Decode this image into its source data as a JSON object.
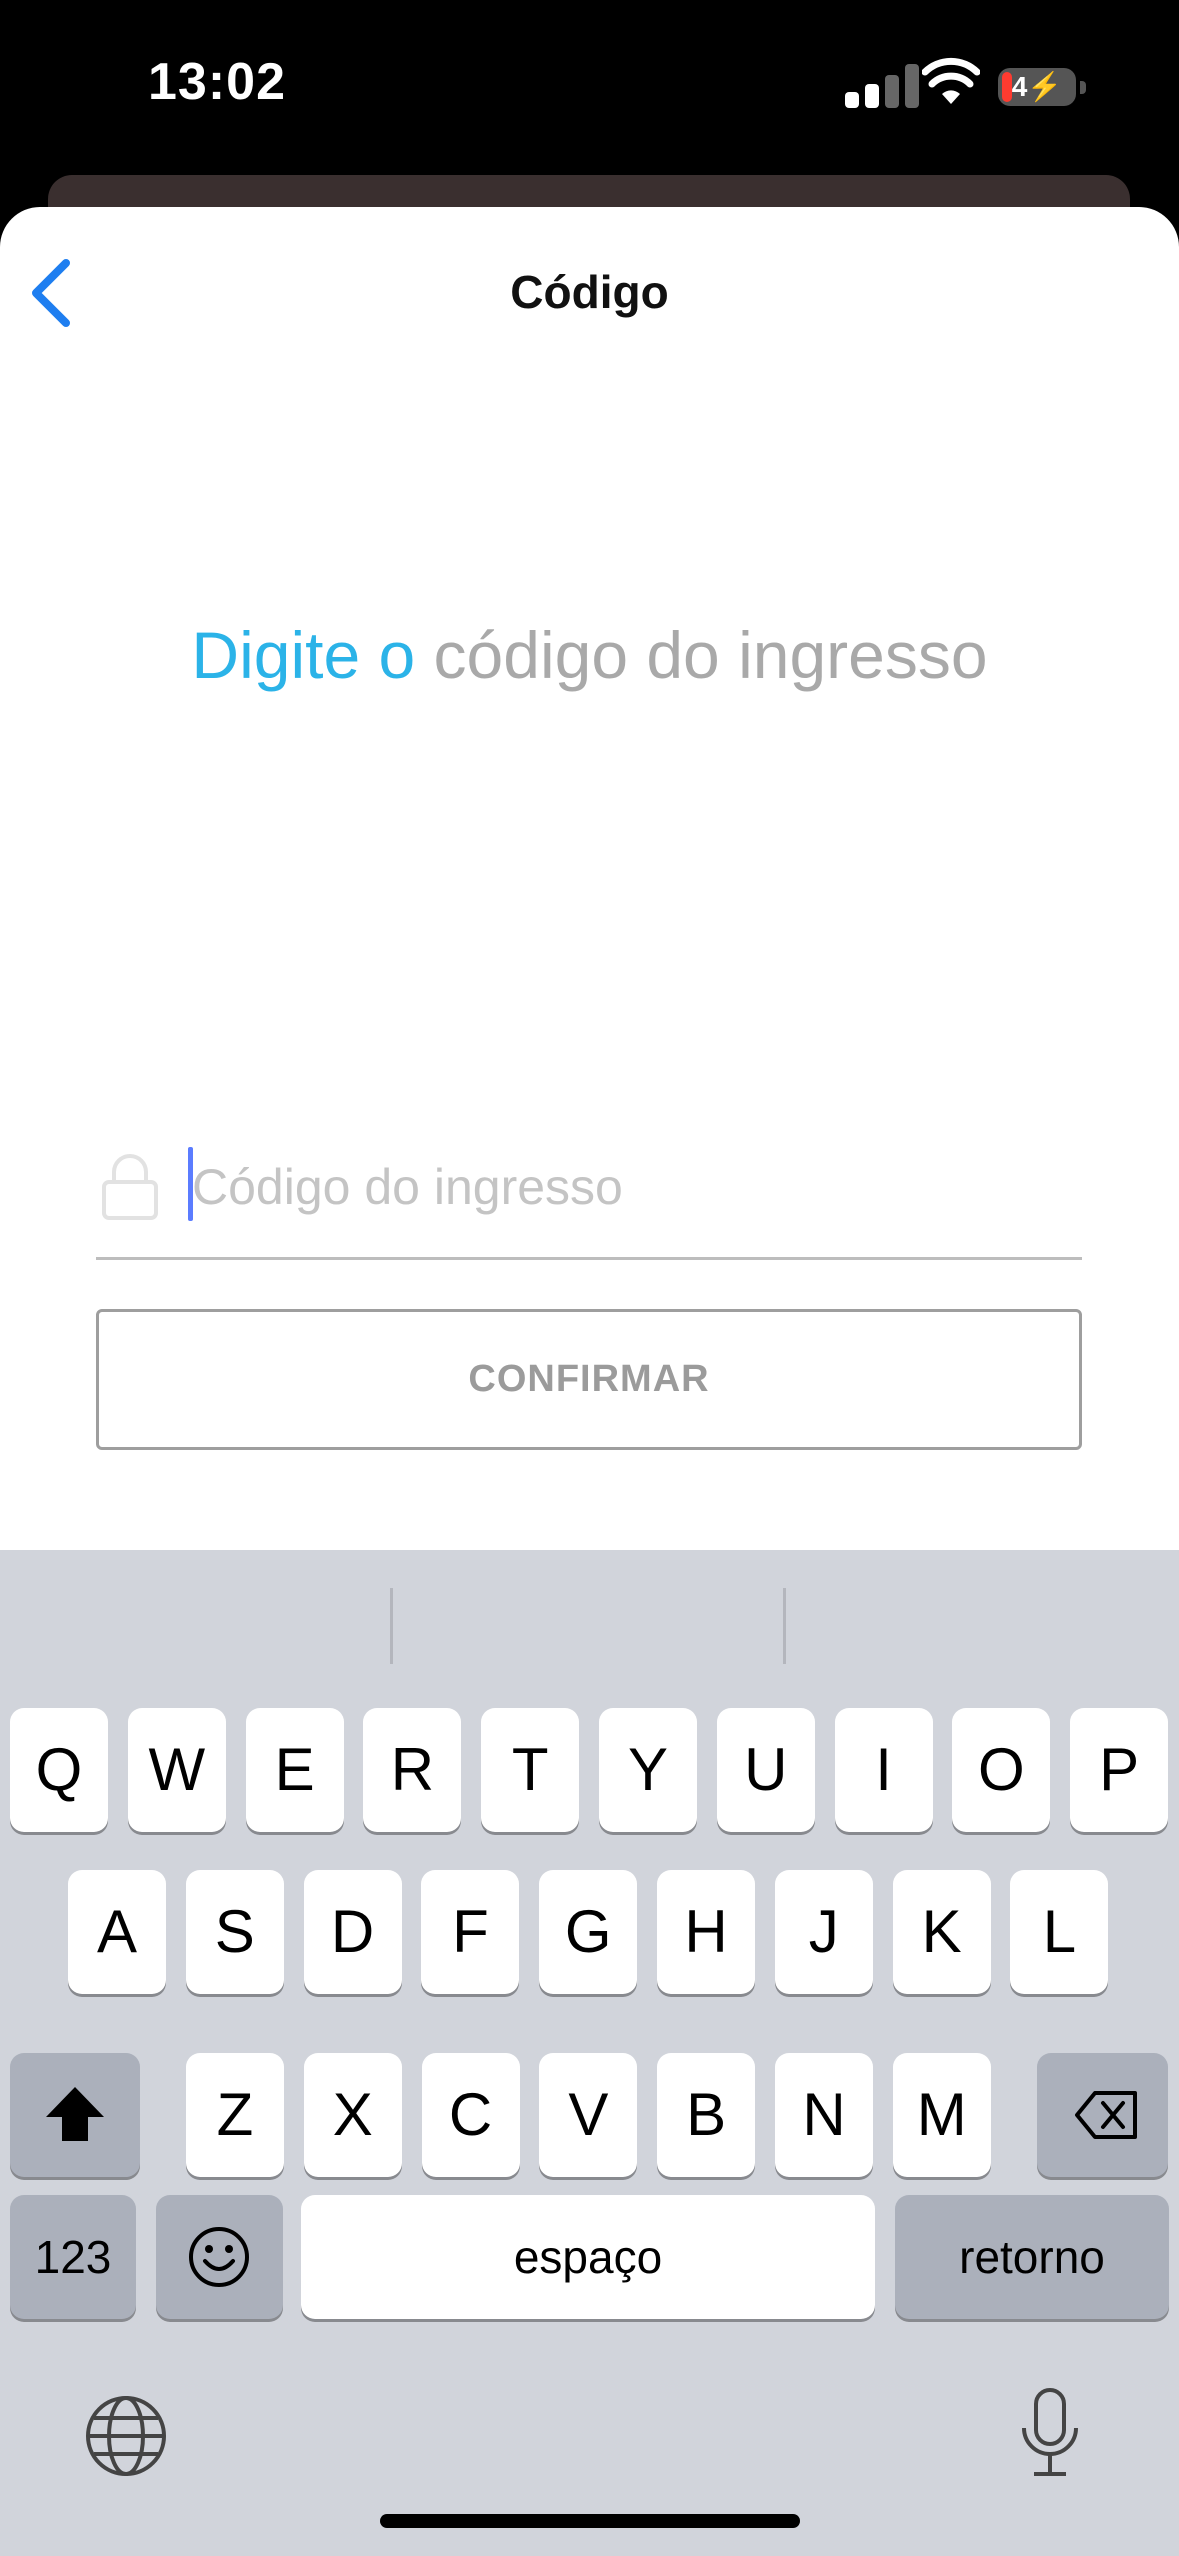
{
  "status": {
    "time": "13:02",
    "battery": "4"
  },
  "nav": {
    "title": "Código"
  },
  "heading": {
    "accent": "Digite o",
    "rest": "código do ingresso"
  },
  "input": {
    "placeholder": "Código do ingresso",
    "value": ""
  },
  "confirm_label": "CONFIRMAR",
  "keyboard": {
    "row1": [
      "Q",
      "W",
      "E",
      "R",
      "T",
      "Y",
      "U",
      "I",
      "O",
      "P"
    ],
    "row2": [
      "A",
      "S",
      "D",
      "F",
      "G",
      "H",
      "J",
      "K",
      "L"
    ],
    "row3": [
      "Z",
      "X",
      "C",
      "V",
      "B",
      "N",
      "M"
    ],
    "numbers_label": "123",
    "space_label": "espaço",
    "return_label": "retorno"
  },
  "colors": {
    "accent": "#2bb3e8",
    "back": "#1e7ef0"
  }
}
